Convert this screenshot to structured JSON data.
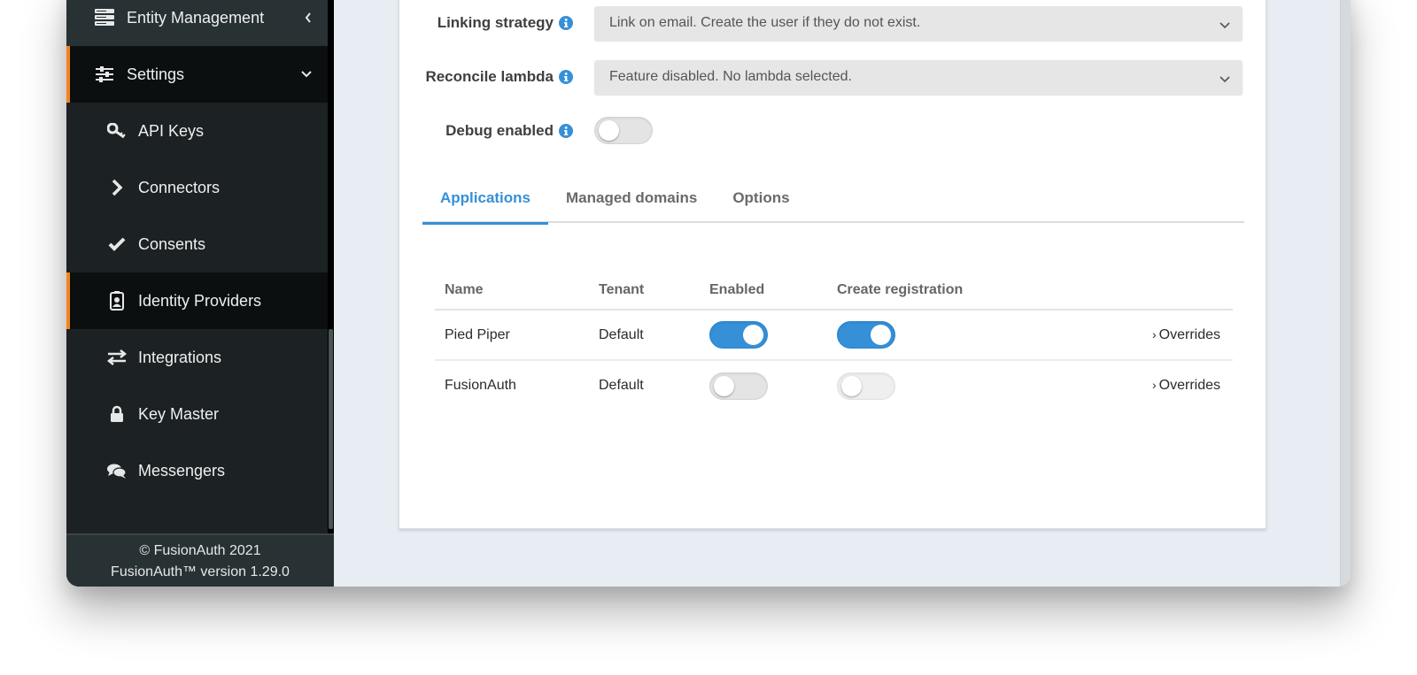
{
  "sidebar": {
    "items": [
      {
        "label": "Entity Management",
        "icon": "server-stack-icon",
        "caret": "chevron-left-icon"
      },
      {
        "label": "Settings",
        "icon": "sliders-icon",
        "caret": "chevron-down-icon"
      }
    ],
    "subitems": [
      {
        "label": "API Keys",
        "icon": "key-icon"
      },
      {
        "label": "Connectors",
        "icon": "chevron-right-icon"
      },
      {
        "label": "Consents",
        "icon": "check-icon"
      },
      {
        "label": "Identity Providers",
        "icon": "id-badge-icon"
      },
      {
        "label": "Integrations",
        "icon": "exchange-icon"
      },
      {
        "label": "Key Master",
        "icon": "lock-icon"
      },
      {
        "label": "Messengers",
        "icon": "comments-icon"
      }
    ],
    "footer": {
      "copyright": "© FusionAuth 2021",
      "version": "FusionAuth™ version 1.29.0"
    }
  },
  "form": {
    "linking_strategy": {
      "label": "Linking strategy",
      "value": "Link on email. Create the user if they do not exist."
    },
    "reconcile_lambda": {
      "label": "Reconcile lambda",
      "value": "Feature disabled. No lambda selected."
    },
    "debug_enabled": {
      "label": "Debug enabled",
      "value": false
    }
  },
  "tabs": [
    {
      "label": "Applications",
      "active": true
    },
    {
      "label": "Managed domains",
      "active": false
    },
    {
      "label": "Options",
      "active": false
    }
  ],
  "applications": {
    "columns": [
      "Name",
      "Tenant",
      "Enabled",
      "Create registration"
    ],
    "rows": [
      {
        "name": "Pied Piper",
        "tenant": "Default",
        "enabled": true,
        "create_registration": true,
        "action": "Overrides"
      },
      {
        "name": "FusionAuth",
        "tenant": "Default",
        "enabled": false,
        "create_registration": false,
        "action": "Overrides"
      }
    ]
  },
  "colors": {
    "accent": "#3590d8",
    "sidebar_active_marker": "#f58320",
    "link": "#2d7ab8"
  }
}
